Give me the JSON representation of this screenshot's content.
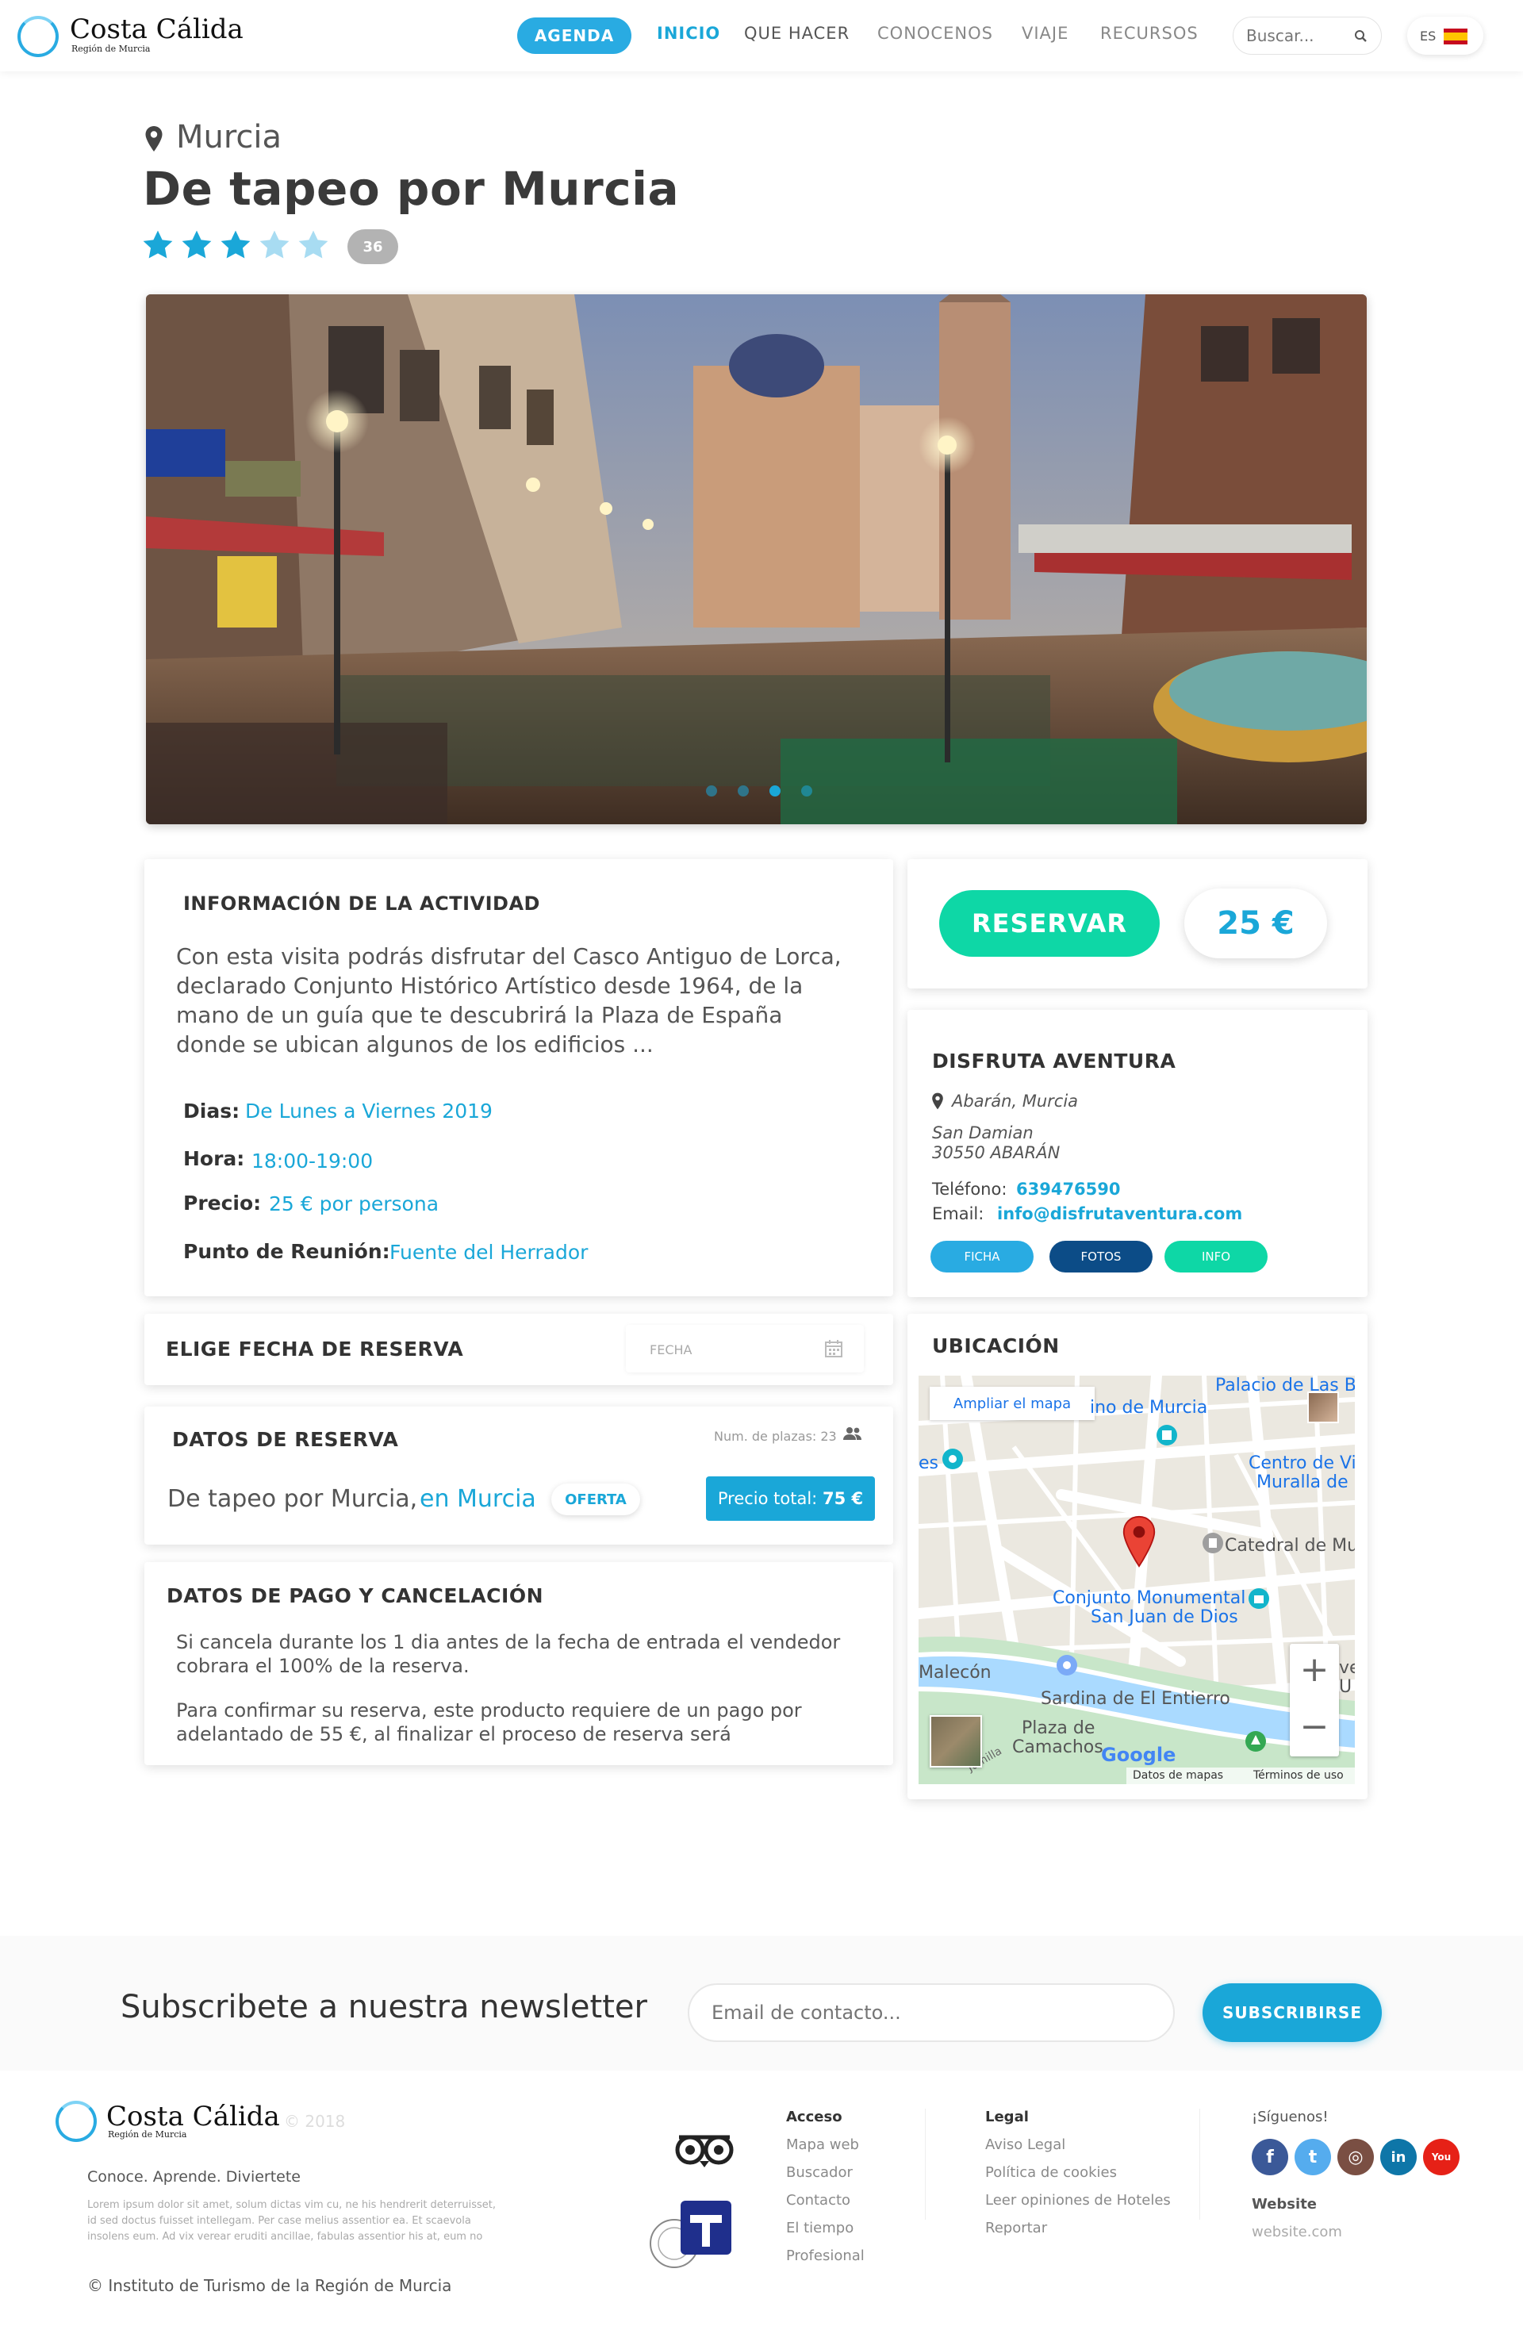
{
  "header": {
    "logo_title": "Costa Cálida",
    "logo_subtitle": "Región de Murcia",
    "agenda_label": "AGENDA",
    "nav": [
      "INICIO",
      "QUE HACER",
      "CONOCENOS",
      "VIAJE",
      "RECURSOS"
    ],
    "search_placeholder": "Buscar...",
    "language": "ES"
  },
  "activity": {
    "location": "Murcia",
    "title": "De tapeo por Murcia",
    "rating": 3,
    "rating_max": 5,
    "review_count": "36",
    "slides": 4,
    "active_slide": 3
  },
  "info": {
    "heading": "INFORMACIÓN DE LA ACTIVIDAD",
    "description": "Con esta visita podrás disfrutar del Casco Antiguo de Lorca, declarado Conjunto Histórico Artístico desde 1964, de la mano de un guía que te descubrirá la Plaza de España donde se ubican algunos de los edificios ...",
    "days_label": "Dias:",
    "days_value": "De Lunes a Viernes 2019",
    "hour_label": "Hora:",
    "hour_value": "18:00-19:00",
    "price_label": "Precio:",
    "price_value": "25 € por persona",
    "meeting_label": "Punto de Reunión:",
    "meeting_value": "Fuente del Herrador"
  },
  "booking": {
    "reserve_label": "RESERVAR",
    "price": "25 €"
  },
  "provider": {
    "name": "DISFRUTA AVENTURA",
    "city": "Abarán, Murcia",
    "address_line1": "San Damian",
    "address_line2": "30550 ABARÁN",
    "phone_label": "Teléfono:",
    "phone": "639476590",
    "email_label": "Email:",
    "email": "info@disfrutaventura.com",
    "buttons": [
      "FICHA",
      "FOTOS",
      "INFO"
    ]
  },
  "date_picker": {
    "heading": "ELIGE FECHA DE RESERVA",
    "placeholder": "FECHA"
  },
  "reservation": {
    "heading": "DATOS DE RESERVA",
    "seats_label": "Num. de plazas: 23",
    "item_name": "De tapeo por Murcia,",
    "item_place": "en Murcia",
    "offer_badge": "OFERTA",
    "total_label": "Precio total:",
    "total_value": "75 €"
  },
  "payment": {
    "heading": "DATOS DE PAGO Y CANCELACIÓN",
    "para1": "Si cancela durante los 1 dia antes de la fecha de entrada el vendedor cobrara el 100% de la reserva.",
    "para2": "Para confirmar su reserva, este producto requiere de un pago por adelantado de 55 €, al finalizar el proceso de reserva será"
  },
  "map": {
    "heading": "UBICACIÓN",
    "enlarge": "Ampliar el mapa",
    "labels": [
      "Palacio de Las B",
      "ino de Murcia",
      "es",
      "Centro de Vi",
      "Muralla de",
      "Catedral de Mur",
      "Conjunto Monumental",
      "San Juan de Dios",
      "Malecón",
      "Sardina de El Entierro",
      "Plaza de",
      "Camachos",
      "ve",
      "U",
      "Jumilla"
    ],
    "google": "Google",
    "map_data": "Datos de mapas",
    "terms": "Términos de uso",
    "zoom_in": "+",
    "zoom_out": "−"
  },
  "newsletter": {
    "title": "Subscribete a nuestra newsletter",
    "placeholder": "Email de contacto...",
    "button": "SUBSCRIBIRSE"
  },
  "footer": {
    "logo_title": "Costa Cálida",
    "logo_subtitle": "Región de Murcia",
    "year": "© 2018",
    "tagline": "Conoce. Aprende. Diviertete",
    "lorem": "Lorem ipsum dolor sit amet, solum dictas vim cu, ne his hendrerit deterruisset, id sed doctus fuisset intellegam. Per case melius assentior ea. Et scaevola insolens eum. Ad vix verear eruditi ancillae, fabulas assentior his at, eum no",
    "copyright": "© Instituto de Turismo de la Región de Murcia",
    "acceso_heading": "Acceso",
    "acceso": [
      "Mapa web",
      "Buscador",
      "Contacto",
      "El tiempo",
      "Profesional"
    ],
    "legal_heading": "Legal",
    "legal": [
      "Aviso Legal",
      "Política de cookies",
      "Leer opiniones de Hoteles",
      "Reportar"
    ],
    "follow_heading": "¡Síguenos!",
    "website_heading": "Website",
    "website": "website.com",
    "social": [
      "facebook",
      "twitter",
      "instagram",
      "linkedin",
      "youtube"
    ]
  }
}
